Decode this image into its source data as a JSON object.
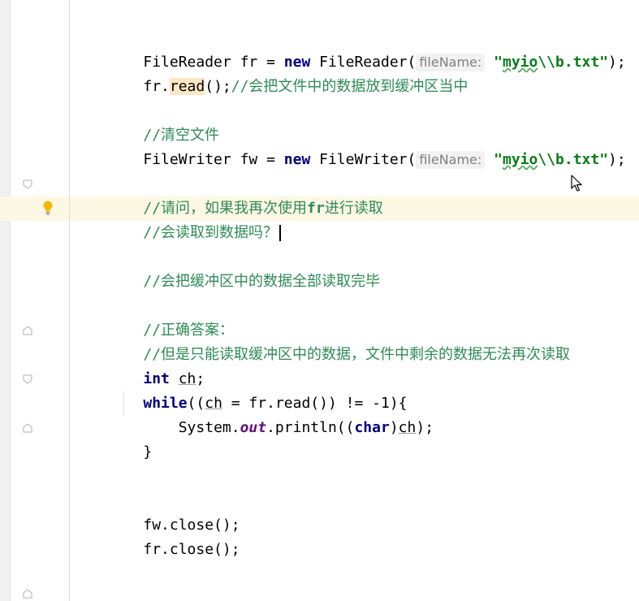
{
  "editor": {
    "lines": {
      "l1": {
        "cls": "FileReader",
        "var": " fr = ",
        "kw_new": "new",
        "ctor": " FileReader(",
        "hint": "fileName:",
        "str_open": " \"",
        "str_word": "myio",
        "str_rest": "\\\\b.txt\"",
        "end": ");"
      },
      "l2": {
        "obj": "fr.",
        "method": "read",
        "rest": "();",
        "comment": "//会把文件中的数据放到缓冲区当中"
      },
      "l3": {
        "comment": "//清空文件"
      },
      "l4": {
        "cls": "FileWriter",
        "var": " fw = ",
        "kw_new": "new",
        "ctor": " FileWriter(",
        "hint": "fileName:",
        "str_open": " \"",
        "str_word": "myio",
        "str_rest": "\\\\b.txt\"",
        "end": ");"
      },
      "l5": {
        "comment_a": "//请问，如果我再次使用",
        "comment_bold": "fr",
        "comment_b": "进行读取"
      },
      "l6": {
        "comment": "//会读取到数据吗？"
      },
      "l7": {
        "comment": "//会把缓冲区中的数据全部读取完毕"
      },
      "l8": {
        "comment": "//正确答案："
      },
      "l9": {
        "comment": "//但是只能读取缓冲区中的数据，文件中剩余的数据无法再次读取"
      },
      "l10": {
        "kw": "int",
        "space": " ",
        "var": "ch",
        "end": ";"
      },
      "l11": {
        "kw": "while",
        "open": "((",
        "var": "ch",
        "rest": " = fr.read()) != -1){"
      },
      "l12": {
        "indent": "    ",
        "cls": "System.",
        "field": "out",
        "call": ".println((",
        "kw": "char",
        "close_cast": ")",
        "var": "ch",
        "end": ");"
      },
      "l13": {
        "text": "}"
      },
      "l14": {
        "text": "fw.close();"
      },
      "l15": {
        "text": "fr.close();"
      },
      "l16": {
        "text": "}"
      }
    }
  }
}
